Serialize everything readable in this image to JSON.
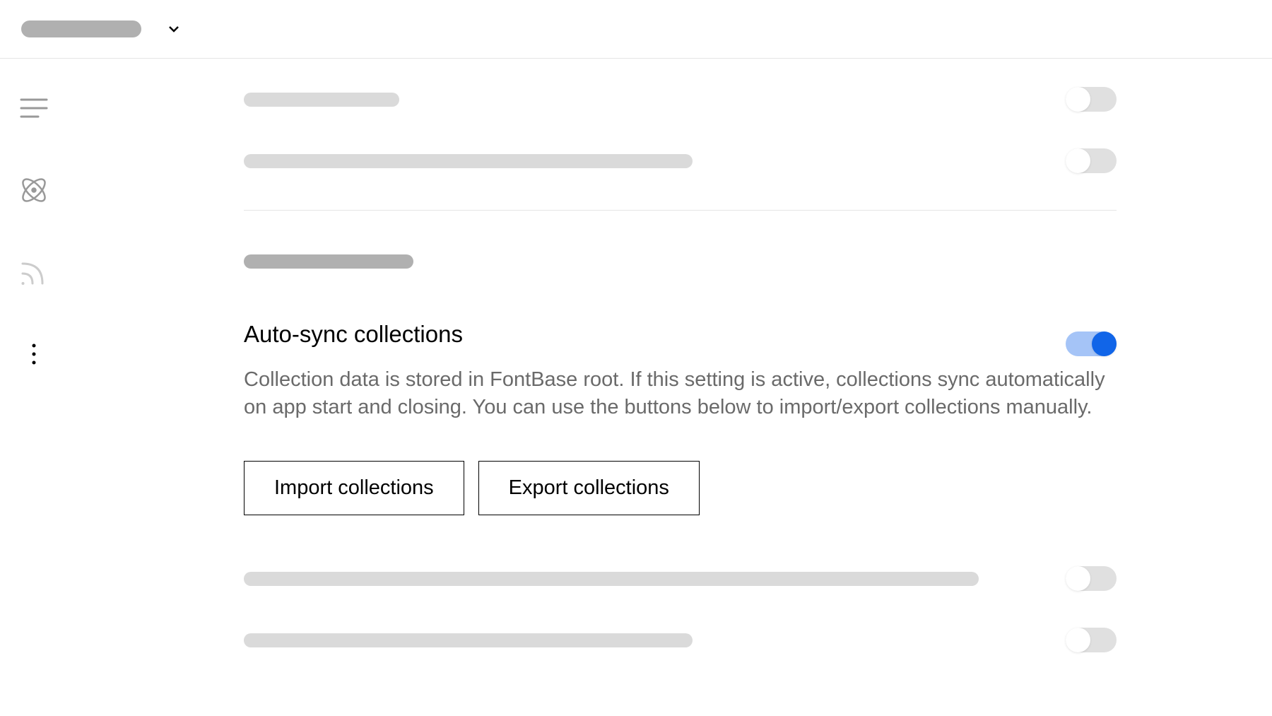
{
  "header": {
    "placeholder": ""
  },
  "sidebar": {
    "items": [
      "menu",
      "atom",
      "rss",
      "more"
    ]
  },
  "settings": {
    "autoSync": {
      "title": "Auto-sync collections",
      "description": "Collection data is stored in FontBase root. If this setting is active, collections sync automatically on app start and closing. You can use the buttons below to import/export collections manually.",
      "enabled": true
    },
    "buttons": {
      "import": "Import collections",
      "export": "Export collections"
    },
    "toggles": {
      "item1": false,
      "item2": false,
      "item3": false,
      "item4": false
    }
  }
}
